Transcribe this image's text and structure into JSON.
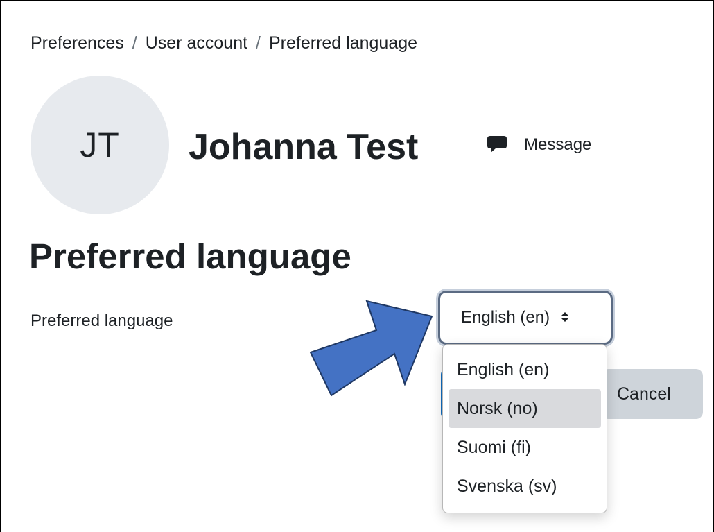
{
  "breadcrumb": {
    "items": [
      "Preferences",
      "User account",
      "Preferred language"
    ],
    "separator": "/"
  },
  "user": {
    "initials": "JT",
    "name": "Johanna Test"
  },
  "header_actions": {
    "message_label": "Message",
    "message_icon": "speech-bubble-icon"
  },
  "page": {
    "heading": "Preferred language"
  },
  "form": {
    "language_label": "Preferred language",
    "language_selected": "English (en)",
    "language_options": [
      "English (en)",
      "Norsk (no)",
      "Suomi (fi)",
      "Svenska (sv)"
    ],
    "hovered_option": "Norsk (no)",
    "cancel_label": "Cancel"
  },
  "colors": {
    "accent_arrow": "#4472c4",
    "primary_button": "#0f6cbf",
    "secondary_button": "#ced4da",
    "avatar_bg": "#e7eaee"
  }
}
